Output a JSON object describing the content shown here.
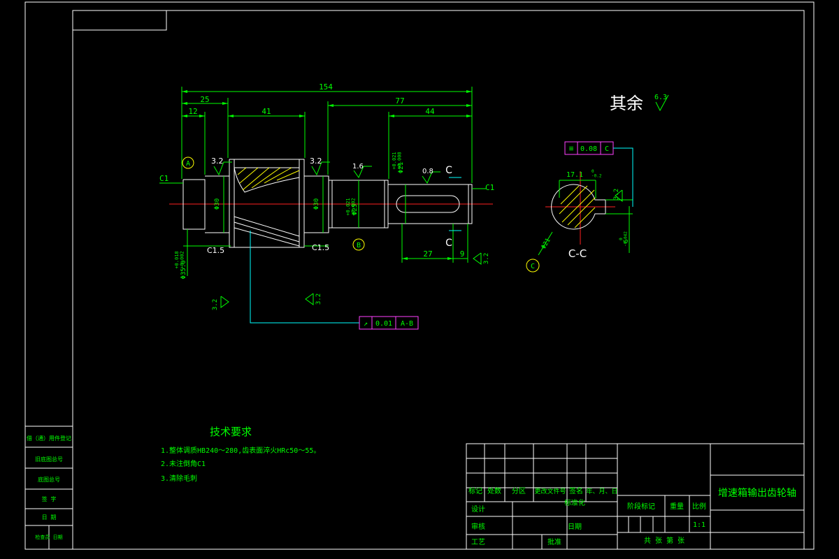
{
  "drawing": {
    "dims": {
      "overall": "154",
      "d25": "25",
      "d12": "12",
      "d41": "41",
      "d77": "77",
      "d44": "44",
      "d27": "27",
      "d9": "9",
      "key_width": "17.1",
      "key_width_tol": "0\n-0.2",
      "key_depth": "6",
      "key_depth_tol": "0\n-0.042",
      "dia_left": "Φ35.0",
      "dia_left_tol": "+0.018\n+0.002",
      "dia_mid": "Φ25",
      "dia_mid_tol": "+0.021\n+0.002",
      "dia_right": "Φ21",
      "dia_right_tol": "+0.021\n+0.008",
      "gear_dia_l": "Φ30",
      "gear_dia_r": "Φ30",
      "section_dia": "Φ21"
    },
    "roughness": {
      "r1": "3.2",
      "r2": "3.2",
      "r3": "1.6",
      "r4": "0.8",
      "r5": "3.2",
      "r6": "3.2",
      "r7": "3.2",
      "r8": "3.2",
      "other_value": "6.3"
    },
    "chamfers": {
      "c1_left": "C1",
      "c1_right": "C1",
      "c15_left": "C1.5",
      "c15_right": "C1.5"
    },
    "datums": {
      "a": "A",
      "b": "B",
      "c": "C"
    },
    "section": {
      "label": "C",
      "title": "C-C"
    },
    "tolerance_frames": {
      "runout_symbol": "↗",
      "runout_value": "0.01",
      "runout_datum": "A-B",
      "sym_symbol": "≡",
      "sym_value": "0.08",
      "sym_datum": "C"
    },
    "other_roughness_label": "其余"
  },
  "tech_req": {
    "title": "技术要求",
    "items": [
      "1.整体调质HB240～280,齿表面淬火HRc50～55。",
      "2.未注倒角C1",
      "3.清除毛刺"
    ]
  },
  "side_table": {
    "rows": [
      "借（通）用件登记",
      "旧底图总号",
      "底图总号",
      "签  字",
      "日  期",
      "检查员  日期"
    ]
  },
  "title_block": {
    "part_name": "增速箱输出齿轮轴",
    "header_cols": [
      "标记",
      "处数",
      "分区",
      "更改文件号",
      "签名",
      "年、月、日"
    ],
    "roles": [
      "设计",
      "审核",
      "工艺"
    ],
    "label_std": "标准化",
    "label_date": "日期",
    "label_approve": "批准",
    "label_stage": "阶段标记",
    "label_weight": "重量",
    "label_scale": "比例",
    "scale_value": "1:1",
    "sheets_text": "共    张   第    张"
  },
  "colors": {
    "background": "#000000",
    "dim": "#00ff00",
    "outline": "#ffffff",
    "center": "#ff2020",
    "hatch": "#ffff00",
    "leader": "#00ffff"
  }
}
